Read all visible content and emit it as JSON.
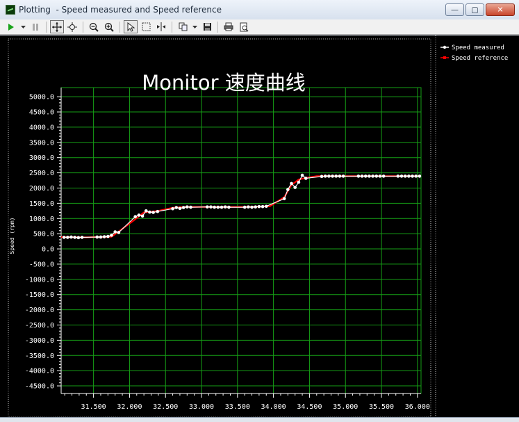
{
  "window": {
    "title": "Plotting  - Speed measured and Speed reference",
    "buttons": {
      "minimize": "—",
      "maximize": "▢",
      "close": "✕"
    }
  },
  "toolbar": {
    "icons": [
      "play-icon",
      "dropdown-arrow-icon",
      "pause-icon",
      "pan-icon",
      "zoom-fit-icon",
      "zoom-out-icon",
      "zoom-in-icon",
      "select-pointer-icon",
      "rectangle-select-icon",
      "cursor-measure-icon",
      "copy-icon",
      "dropdown-arrow-icon",
      "save-icon",
      "print-icon",
      "print-preview-icon"
    ]
  },
  "colors": {
    "background": "#000000",
    "grid": "#16a016",
    "axis": "#ffffff",
    "measured": "#ffffff",
    "reference": "#ff0000"
  },
  "chart_data": {
    "type": "line",
    "title": "Monitor 速度曲线",
    "xlabel": "",
    "ylabel": "Speed (rpm)",
    "xlim": [
      31.05,
      36.05
    ],
    "ylim": [
      -4750,
      5300
    ],
    "x_ticks": [
      31.5,
      32.0,
      32.5,
      33.0,
      33.5,
      34.0,
      34.5,
      35.0,
      35.5,
      36.0
    ],
    "x_tick_labels": [
      "31.500",
      "32.000",
      "32.500",
      "33.000",
      "33.500",
      "34.000",
      "34.500",
      "35.000",
      "35.500",
      "36.000"
    ],
    "y_ticks": [
      5000,
      4500,
      4000,
      3500,
      3000,
      2500,
      2000,
      1500,
      1000,
      500,
      0,
      -500,
      -1000,
      -1500,
      -2000,
      -2500,
      -3000,
      -3500,
      -4000,
      -4500
    ],
    "y_tick_labels": [
      "5000.0",
      "4500.0",
      "4000.0",
      "3500.0",
      "3000.0",
      "2500.0",
      "2000.0",
      "1500.0",
      "1000.0",
      "500.0",
      "0.0",
      "-500.0",
      "-1000.0",
      "-1500.0",
      "-2000.0",
      "-2500.0",
      "-3000.0",
      "-3500.0",
      "-4000.0",
      "-4500.0"
    ],
    "grid": true,
    "legend_position": "top-right",
    "series": [
      {
        "name": "Speed measured",
        "color": "#ffffff",
        "marker": "circle",
        "x": [
          31.09,
          31.14,
          31.19,
          31.24,
          31.29,
          31.34,
          31.55,
          31.6,
          31.65,
          31.7,
          31.75,
          31.8,
          31.85,
          32.08,
          32.13,
          32.18,
          32.23,
          32.28,
          32.33,
          32.39,
          32.6,
          32.65,
          32.7,
          32.75,
          32.8,
          32.85,
          33.08,
          33.13,
          33.18,
          33.23,
          33.28,
          33.33,
          33.38,
          33.6,
          33.65,
          33.7,
          33.75,
          33.8,
          33.85,
          33.9,
          34.15,
          34.2,
          34.25,
          34.3,
          34.35,
          34.4,
          34.45,
          34.67,
          34.72,
          34.77,
          34.82,
          34.87,
          34.92,
          34.97,
          35.18,
          35.23,
          35.28,
          35.33,
          35.38,
          35.43,
          35.48,
          35.53,
          35.73,
          35.78,
          35.83,
          35.88,
          35.93,
          35.98,
          36.03
        ],
        "y": [
          380,
          380,
          390,
          380,
          370,
          380,
          390,
          390,
          400,
          410,
          450,
          560,
          540,
          1060,
          1110,
          1080,
          1250,
          1210,
          1200,
          1230,
          1320,
          1360,
          1330,
          1360,
          1380,
          1370,
          1380,
          1380,
          1370,
          1370,
          1370,
          1380,
          1370,
          1370,
          1380,
          1370,
          1380,
          1390,
          1390,
          1400,
          1650,
          1950,
          2150,
          2020,
          2190,
          2420,
          2320,
          2380,
          2390,
          2390,
          2390,
          2390,
          2390,
          2390,
          2390,
          2390,
          2390,
          2390,
          2390,
          2390,
          2390,
          2390,
          2390,
          2390,
          2390,
          2390,
          2390,
          2390,
          2390
        ]
      },
      {
        "name": "Speed reference",
        "color": "#ff0000",
        "marker": "square",
        "x": [
          31.05,
          31.4,
          31.5,
          31.75,
          32.05,
          32.2,
          32.4,
          32.6,
          32.75,
          32.95,
          33.1,
          33.6,
          33.95,
          34.15,
          34.25,
          34.35,
          34.45,
          34.6,
          36.05
        ],
        "y": [
          390,
          380,
          390,
          400,
          920,
          1200,
          1250,
          1350,
          1380,
          1380,
          1380,
          1380,
          1400,
          1700,
          2100,
          2280,
          2330,
          2390,
          2390
        ]
      }
    ]
  }
}
